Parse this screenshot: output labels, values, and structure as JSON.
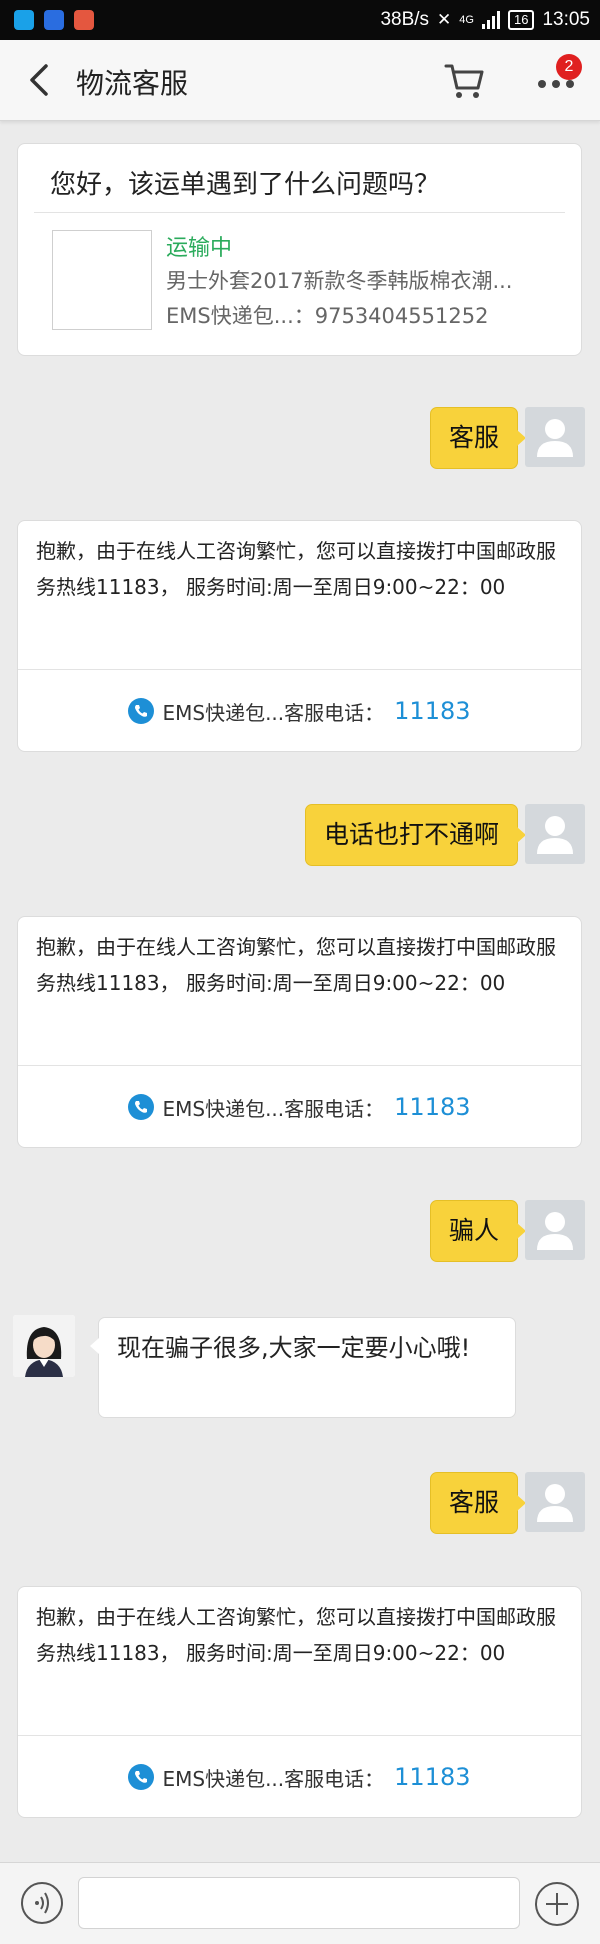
{
  "status_bar": {
    "network_speed": "38B/s",
    "network_type": "4G",
    "battery": "16",
    "time": "13:05"
  },
  "header": {
    "title": "物流客服",
    "cart_badge": "2"
  },
  "order_card": {
    "question": "您好，该运单遇到了什么问题吗？",
    "status": "运输中",
    "status_color": "#2bab5c",
    "product": "男士外套2017新款冬季韩版棉衣潮...",
    "tracking": "EMS快递包...：9753404551252"
  },
  "auto_reply": {
    "text": "抱歉，由于在线人工咨询繁忙，您可以直接拨打中国邮政服务热线11183， 服务时间:周一至周日9:00~22：00",
    "phone_label": "EMS快递包...客服电话：",
    "phone_number": "11183",
    "phone_color": "#1d8fd6"
  },
  "messages": {
    "user_1": "客服",
    "user_2": "电话也打不通啊",
    "user_3": "骗人",
    "agent_1": "现在骗子很多,大家一定要小心哦!",
    "user_4": "客服"
  },
  "colors": {
    "user_bubble": "#f8d23b",
    "background": "#ebebeb"
  },
  "input": {
    "placeholder": ""
  }
}
